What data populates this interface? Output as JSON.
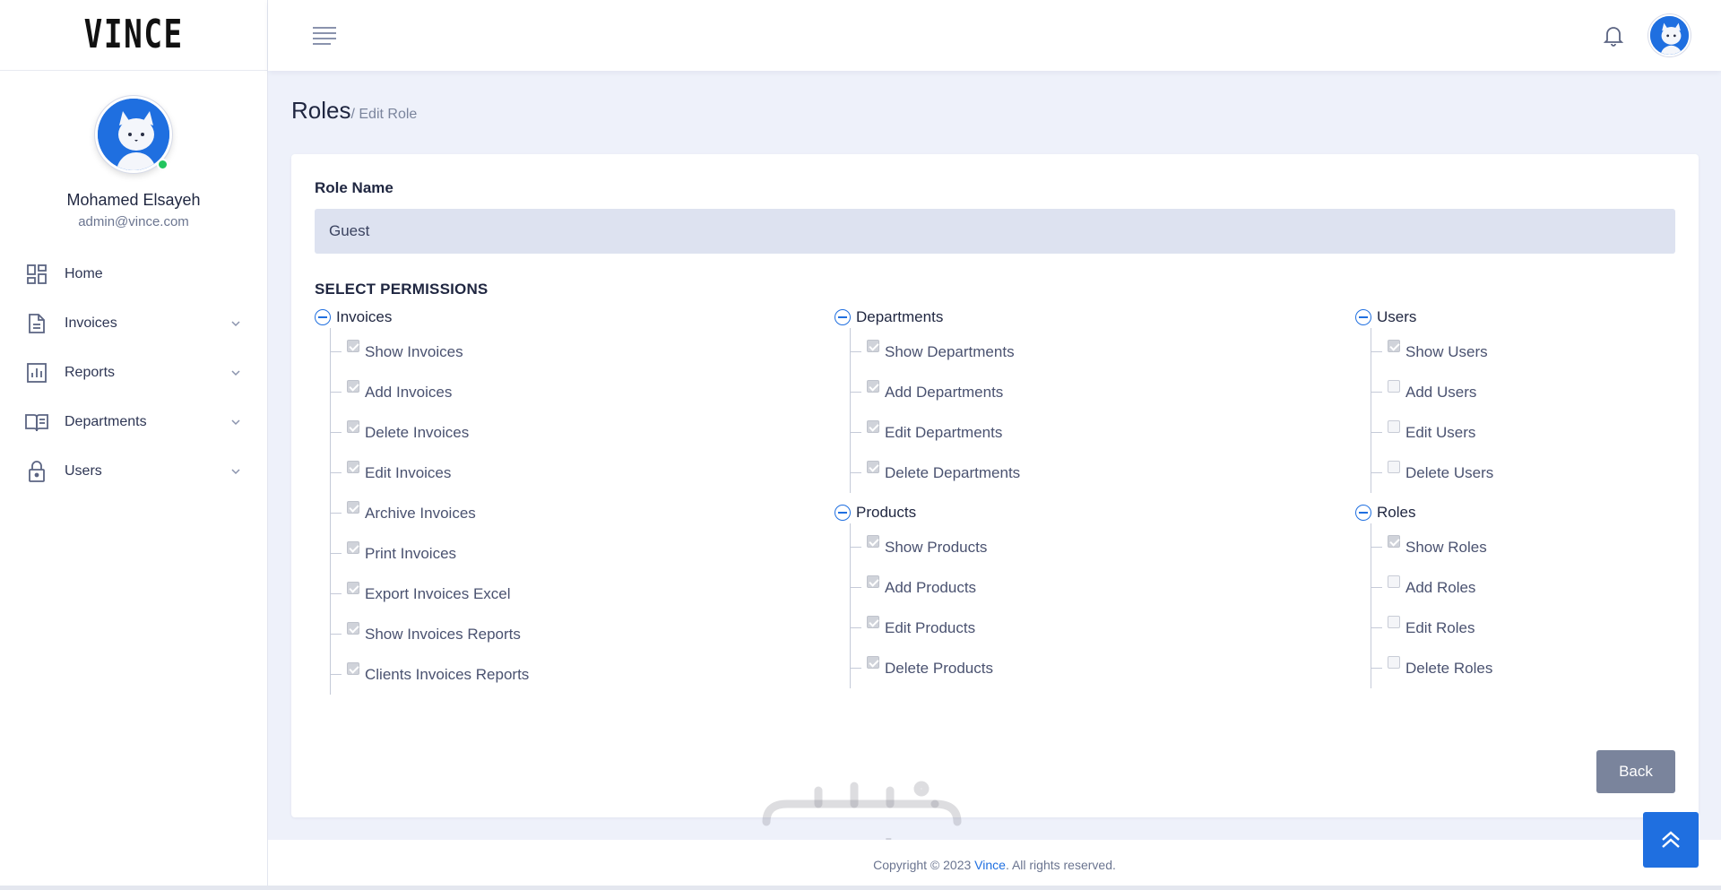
{
  "brand": {
    "logo_text": "VINCE"
  },
  "profile": {
    "name": "Mohamed Elsayeh",
    "email": "admin@vince.com"
  },
  "nav": {
    "items": [
      {
        "label": "Home",
        "icon": "dashboard-grid-icon",
        "has_children": false
      },
      {
        "label": "Invoices",
        "icon": "document-icon",
        "has_children": true
      },
      {
        "label": "Reports",
        "icon": "bar-chart-icon",
        "has_children": true
      },
      {
        "label": "Departments",
        "icon": "open-book-icon",
        "has_children": true
      },
      {
        "label": "Users",
        "icon": "lock-icon",
        "has_children": true
      }
    ]
  },
  "breadcrumb": {
    "title": "Roles",
    "sub": "/ Edit Role"
  },
  "form": {
    "role_name_label": "Role Name",
    "role_name_value": "Guest",
    "permissions_title": "SELECT PERMISSIONS",
    "back_label": "Back"
  },
  "permissions": {
    "invoices": {
      "name": "Invoices",
      "items": [
        {
          "label": "Show Invoices",
          "checked": true
        },
        {
          "label": "Add Invoices",
          "checked": true
        },
        {
          "label": "Delete Invoices",
          "checked": true
        },
        {
          "label": "Edit Invoices",
          "checked": true
        },
        {
          "label": "Archive Invoices",
          "checked": true
        },
        {
          "label": "Print Invoices",
          "checked": true
        },
        {
          "label": "Export Invoices Excel",
          "checked": true
        },
        {
          "label": "Show Invoices Reports",
          "checked": true
        },
        {
          "label": "Clients Invoices Reports",
          "checked": true
        }
      ]
    },
    "departments": {
      "name": "Departments",
      "items": [
        {
          "label": "Show Departments",
          "checked": true
        },
        {
          "label": "Add Departments",
          "checked": true
        },
        {
          "label": "Edit Departments",
          "checked": true
        },
        {
          "label": "Delete Departments",
          "checked": true
        }
      ]
    },
    "products": {
      "name": "Products",
      "items": [
        {
          "label": "Show Products",
          "checked": true
        },
        {
          "label": "Add Products",
          "checked": true
        },
        {
          "label": "Edit Products",
          "checked": true
        },
        {
          "label": "Delete Products",
          "checked": true
        }
      ]
    },
    "users": {
      "name": "Users",
      "items": [
        {
          "label": "Show Users",
          "checked": true
        },
        {
          "label": "Add Users",
          "checked": false
        },
        {
          "label": "Edit Users",
          "checked": false
        },
        {
          "label": "Delete Users",
          "checked": false
        }
      ]
    },
    "roles": {
      "name": "Roles",
      "items": [
        {
          "label": "Show Roles",
          "checked": true
        },
        {
          "label": "Add Roles",
          "checked": false
        },
        {
          "label": "Edit Roles",
          "checked": false
        },
        {
          "label": "Delete Roles",
          "checked": false
        }
      ]
    }
  },
  "watermark": {
    "latin": "mostaql.com"
  },
  "footer": {
    "prefix": "Copyright © 2023 ",
    "brand": "Vince",
    "suffix": ". All rights reserved."
  },
  "colors": {
    "accent": "#1f6fe0",
    "online": "#22c55e",
    "button_muted": "#7a849c",
    "input_bg": "#dde2f0"
  }
}
